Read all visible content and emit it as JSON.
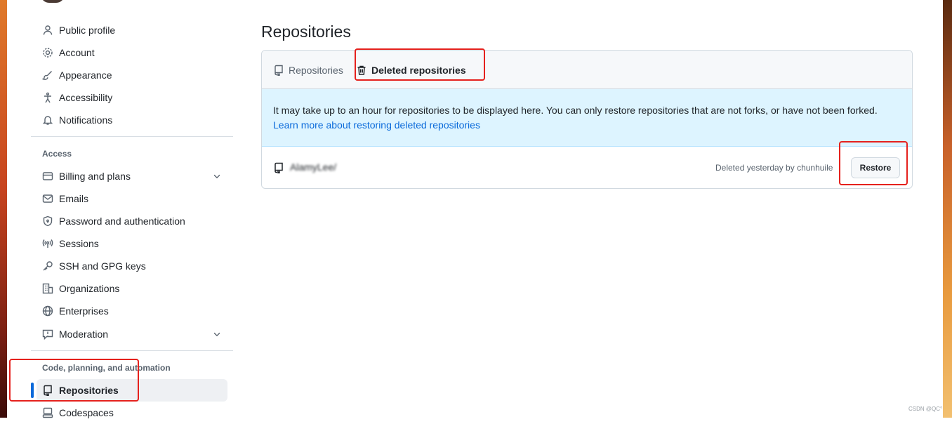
{
  "sidebar": {
    "items_top": [
      {
        "label": "Public profile",
        "icon": "person-icon"
      },
      {
        "label": "Account",
        "icon": "gear-icon"
      },
      {
        "label": "Appearance",
        "icon": "paintbrush-icon"
      },
      {
        "label": "Accessibility",
        "icon": "accessibility-icon"
      },
      {
        "label": "Notifications",
        "icon": "bell-icon"
      }
    ],
    "access_title": "Access",
    "access_items": [
      {
        "label": "Billing and plans",
        "icon": "credit-card-icon"
      },
      {
        "label": "Emails",
        "icon": "mail-icon"
      },
      {
        "label": "Password and authentication",
        "icon": "shield-lock-icon"
      },
      {
        "label": "Sessions",
        "icon": "broadcast-icon"
      },
      {
        "label": "SSH and GPG keys",
        "icon": "key-icon"
      },
      {
        "label": "Organizations",
        "icon": "organization-icon"
      },
      {
        "label": "Enterprises",
        "icon": "globe-icon"
      },
      {
        "label": "Moderation",
        "icon": "report-icon"
      }
    ],
    "code_title": "Code, planning, and automation",
    "code_items": [
      {
        "label": "Repositories",
        "icon": "repo-icon",
        "active": true
      },
      {
        "label": "Codespaces",
        "icon": "codespaces-icon"
      }
    ]
  },
  "main": {
    "title": "Repositories",
    "tabs": [
      {
        "label": "Repositories",
        "icon": "repo-icon"
      },
      {
        "label": "Deleted repositories",
        "icon": "trash-icon",
        "active": true
      }
    ],
    "notice": {
      "text": "It may take up to an hour for repositories to be displayed here. You can only restore repositories that are not forks, or have not been forked.",
      "link": "Learn more about restoring deleted repositories"
    },
    "deleted_repo": {
      "name": "AlamyLee/",
      "meta": "Deleted yesterday by chunhuile",
      "restore_label": "Restore"
    }
  },
  "watermark": "CSDN @QC°",
  "colors": {
    "accent": "#0969da",
    "annotation": "#e5211d",
    "notice_bg": "#ddf4ff"
  }
}
